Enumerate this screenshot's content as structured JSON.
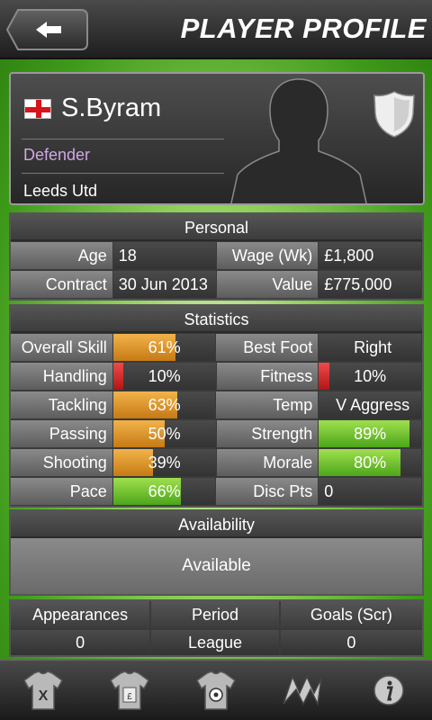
{
  "header": {
    "title": "PLAYER PROFILE",
    "back_icon": "arrow-left-icon"
  },
  "profile": {
    "name": "S.Byram",
    "position": "Defender",
    "club": "Leeds Utd",
    "nationality_flag": "england-flag-icon"
  },
  "personal": {
    "title": "Personal",
    "rows": [
      {
        "l1": "Age",
        "v1": "18",
        "l2": "Wage (Wk)",
        "v2": "£1,800"
      },
      {
        "l1": "Contract",
        "v1": "30 Jun 2013",
        "l2": "Value",
        "v2": "£775,000"
      }
    ]
  },
  "statistics": {
    "title": "Statistics",
    "rows": [
      {
        "l1": "Overall Skill",
        "v1": "61%",
        "p1": 0.61,
        "c1": "orange",
        "l2": "Best Foot",
        "v2": "Right"
      },
      {
        "l1": "Handling",
        "v1": "10%",
        "p1": 0.1,
        "c1": "red",
        "l2": "Fitness",
        "v2": "10%",
        "p2": 0.1,
        "c2": "red"
      },
      {
        "l1": "Tackling",
        "v1": "63%",
        "p1": 0.63,
        "c1": "orange",
        "l2": "Temp",
        "v2": "V Aggress"
      },
      {
        "l1": "Passing",
        "v1": "50%",
        "p1": 0.5,
        "c1": "orange",
        "l2": "Strength",
        "v2": "89%",
        "p2": 0.89,
        "c2": "green"
      },
      {
        "l1": "Shooting",
        "v1": "39%",
        "p1": 0.39,
        "c1": "orange",
        "l2": "Morale",
        "v2": "80%",
        "p2": 0.8,
        "c2": "green"
      },
      {
        "l1": "Pace",
        "v1": "66%",
        "p1": 0.66,
        "c1": "green",
        "l2": "Disc Pts",
        "v2": "0"
      }
    ]
  },
  "availability": {
    "title": "Availability",
    "status": "Available"
  },
  "appearances": {
    "headers": [
      "Appearances",
      "Period",
      "Goals (Scr)"
    ],
    "values": [
      "0",
      "League",
      "0"
    ]
  },
  "tabbar": {
    "items": [
      "shirt-x-icon",
      "shirt-pound-icon",
      "shirt-ball-icon",
      "logo-icon",
      "info-icon"
    ]
  }
}
